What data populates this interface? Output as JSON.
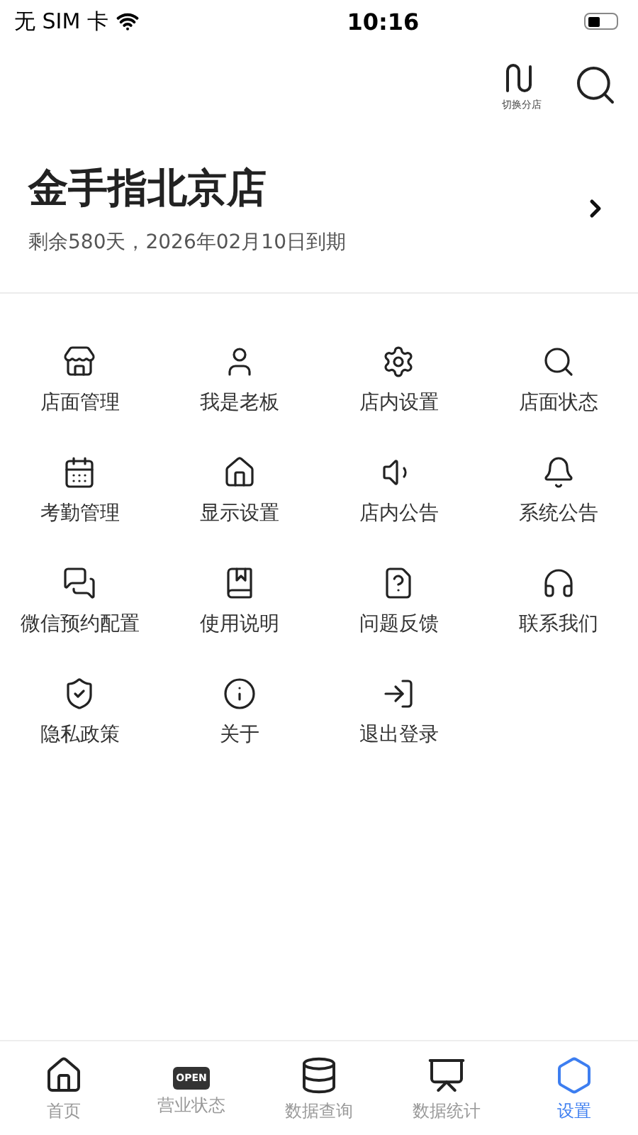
{
  "status_bar": {
    "carrier": "无 SIM 卡",
    "time": "10:16"
  },
  "header": {
    "switch_label": "切换分店"
  },
  "store": {
    "name": "金手指北京店",
    "expiry": "剩余580天，2026年02月10日到期"
  },
  "menu": [
    {
      "label": "店面管理"
    },
    {
      "label": "我是老板"
    },
    {
      "label": "店内设置"
    },
    {
      "label": "店面状态"
    },
    {
      "label": "考勤管理"
    },
    {
      "label": "显示设置"
    },
    {
      "label": "店内公告"
    },
    {
      "label": "系统公告"
    },
    {
      "label": "微信预约配置"
    },
    {
      "label": "使用说明"
    },
    {
      "label": "问题反馈"
    },
    {
      "label": "联系我们"
    },
    {
      "label": "隐私政策"
    },
    {
      "label": "关于"
    },
    {
      "label": "退出登录"
    }
  ],
  "tab_bar": [
    {
      "label": "首页",
      "selected": false
    },
    {
      "label": "营业状态",
      "selected": false,
      "sign_text": "OPEN"
    },
    {
      "label": "数据查询",
      "selected": false
    },
    {
      "label": "数据统计",
      "selected": false
    },
    {
      "label": "设置",
      "selected": true
    }
  ]
}
